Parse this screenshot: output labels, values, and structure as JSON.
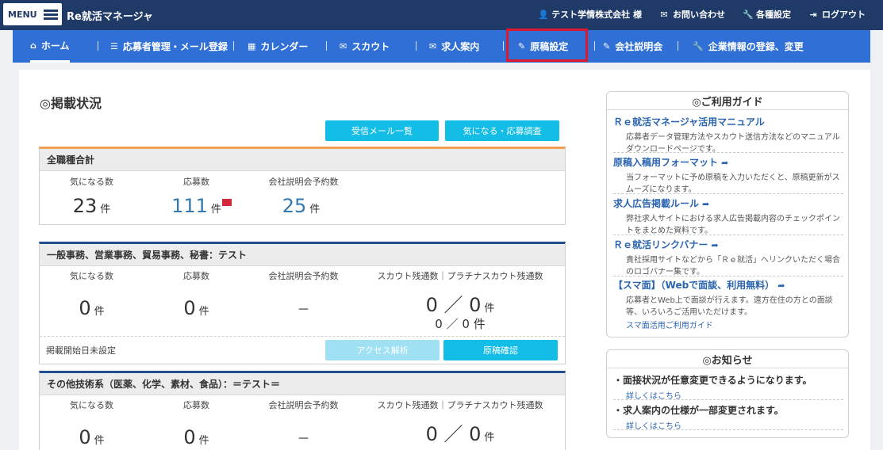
{
  "header": {
    "menu_label": "MENU",
    "brand": "Re就活マネージャ",
    "links": [
      {
        "icon": "user-icon",
        "label": "テスト学情株式会社 様"
      },
      {
        "icon": "mail-icon",
        "label": "お問い合わせ"
      },
      {
        "icon": "wrench-icon",
        "label": "各種設定"
      },
      {
        "icon": "logout-icon",
        "label": "ログアウト"
      }
    ]
  },
  "nav": {
    "items": [
      {
        "icon": "home-icon",
        "label": "ホーム"
      },
      {
        "icon": "list-icon",
        "label": "応募者管理・メール登録"
      },
      {
        "icon": "calendar-icon",
        "label": "カレンダー"
      },
      {
        "icon": "mail-icon",
        "label": "スカウト"
      },
      {
        "icon": "mail-icon",
        "label": "求人案内"
      },
      {
        "icon": "pencil-icon",
        "label": "原稿設定"
      },
      {
        "icon": "pencil-icon",
        "label": "会社説明会"
      },
      {
        "icon": "wrench-icon",
        "label": "企業情報の登録、変更"
      }
    ],
    "highlight_color": "#e0182d"
  },
  "main": {
    "title": "◎掲載状況",
    "buttons": {
      "inbox": "受信メール一覧",
      "survey": "気になる・応募調査"
    },
    "total": {
      "heading": "全職種合計",
      "labels": [
        "気になる数",
        "応募数",
        "会社説明会予約数"
      ],
      "values": [
        "23",
        "111",
        "25"
      ],
      "unit": "件"
    },
    "jobs": [
      {
        "heading": "一般事務、営業事務、貿易事務、秘書：テスト",
        "labels": [
          "気になる数",
          "応募数",
          "会社説明会予約数",
          "スカウト残通数｜プラチナスカウト残通数"
        ],
        "interest": "0",
        "apply": "0",
        "seminar": "－",
        "scout_main": "0 ／ 0",
        "scout_sub": "0 ／ 0 件",
        "unit": "件",
        "status": "掲載開始日未設定",
        "access_btn": "アクセス解析",
        "confirm_btn": "原稿確認"
      },
      {
        "heading": "その他技術系（医薬、化学、素材、食品）：＝テスト＝",
        "labels": [
          "気になる数",
          "応募数",
          "会社説明会予約数",
          "スカウト残通数｜プラチナスカウト残通数"
        ],
        "interest": "0",
        "apply": "0",
        "seminar": "－",
        "scout_main": "0 ／ 0",
        "unit": "件"
      }
    ]
  },
  "guide": {
    "title": "◎ご利用ガイド",
    "items": [
      {
        "title": "Ｒｅ就活マネージャ活用マニュアル",
        "desc": "応募者データ管理方法やスカウト送信方法などのマニュアルダウンロードページです。"
      },
      {
        "title": "原稿入稿用フォーマット",
        "desc": "当フォーマットに予め原稿を入力いただくと、原稿更新がスムーズになります。"
      },
      {
        "title": "求人広告掲載ルール",
        "desc": "弊社求人サイトにおける求人広告掲載内容のチェックポイントをまとめた資料です。"
      },
      {
        "title": "Ｒｅ就活リンクバナー",
        "desc": "貴社採用サイトなどから「Ｒｅ就活」へリンクいただく場合のロゴバナー集です。"
      },
      {
        "title": "【スマ面】（Webで面談、利用無料）",
        "desc": "応募者とWeb上で面談が行えます。遠方在住の方との面談等、いろいろご活用いただけます。",
        "link": "スマ面活用ご利用ガイド"
      }
    ]
  },
  "news": {
    "title": "◎お知らせ",
    "items": [
      {
        "title": "・面接状況が任意変更できるようになります。",
        "link": "詳しくはこちら"
      },
      {
        "title": "・求人案内の仕様が一部変更されます。",
        "link": "詳しくはこちら"
      }
    ]
  },
  "colors": {
    "header_bg": "#1f3a66",
    "nav_bg": "#2f6fd6",
    "accent_cyan": "#14bde6",
    "total_border": "#f0a050",
    "job_border": "#1f4f8f",
    "link_blue": "#2a64b0"
  }
}
